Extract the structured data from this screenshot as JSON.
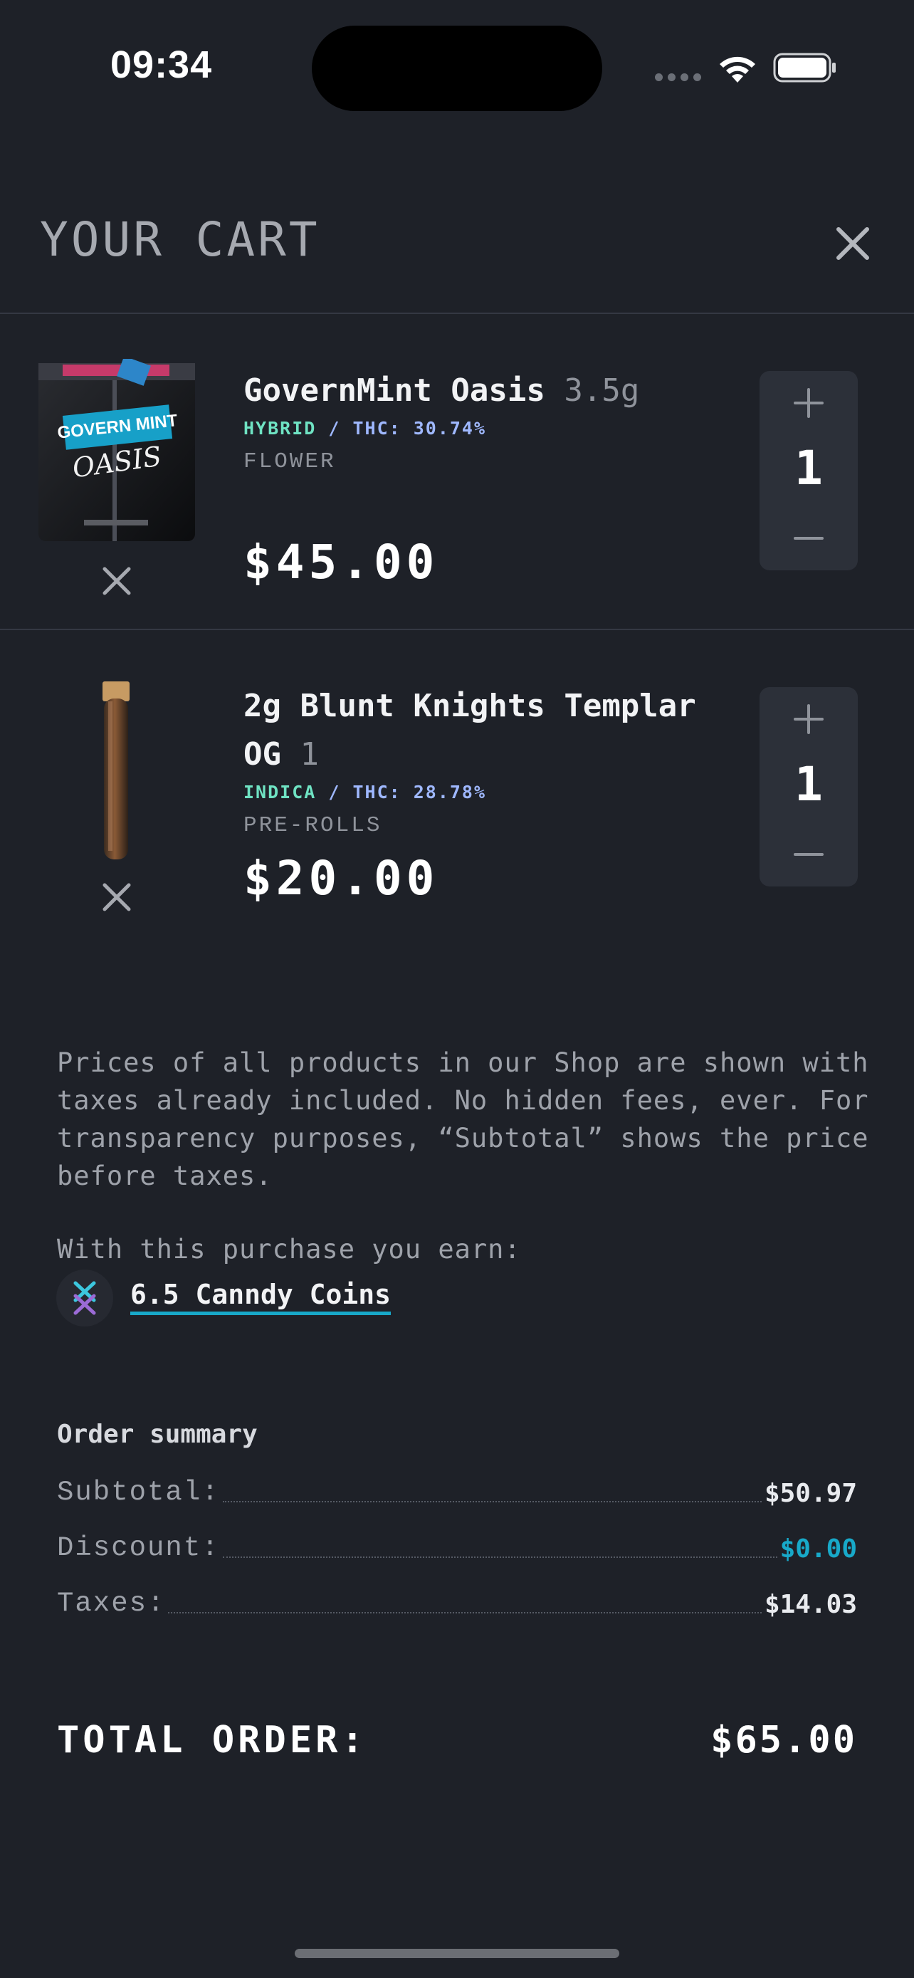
{
  "status_bar": {
    "time": "09:34"
  },
  "header": {
    "title": "YOUR CART"
  },
  "cart_items": [
    {
      "name": "GovernMint Oasis",
      "size": "3.5g",
      "strain_type": "HYBRID",
      "thc": "THC: 30.74%",
      "category": "FLOWER",
      "price": "$45.00",
      "quantity": "1",
      "image_icon": "flower-box-icon",
      "box_label_top": "GOVERN MINT",
      "box_label_script": "OASIS"
    },
    {
      "name": "2g Blunt Knights Templar OG",
      "size": "1",
      "strain_type": "INDICA",
      "thc": "THC: 28.78%",
      "category": "PRE-ROLLS",
      "price": "$20.00",
      "quantity": "1",
      "image_icon": "pre-roll-tube-icon"
    }
  ],
  "info": {
    "disclaimer": "Prices of all products in our Shop are shown with taxes already included. No hidden fees, ever. For transparency purposes, “Subtotal” shows the price before taxes.",
    "earn_label": "With this purchase you earn:",
    "coins_text": "6.5 Canndy Coins"
  },
  "summary": {
    "heading": "Order summary",
    "rows": [
      {
        "label": "Subtotal:",
        "value": "$50.97"
      },
      {
        "label": "Discount:",
        "value": "$0.00"
      },
      {
        "label": "Taxes:",
        "value": "$14.03"
      }
    ],
    "total_label": "TOTAL ORDER:",
    "total_value": "$65.00"
  },
  "colors": {
    "background": "#1e2128",
    "accent": "#18a9c9",
    "strain_type": "#6fe3c3",
    "thc": "#9fb8ff",
    "stepper_bg": "#2c3039"
  }
}
